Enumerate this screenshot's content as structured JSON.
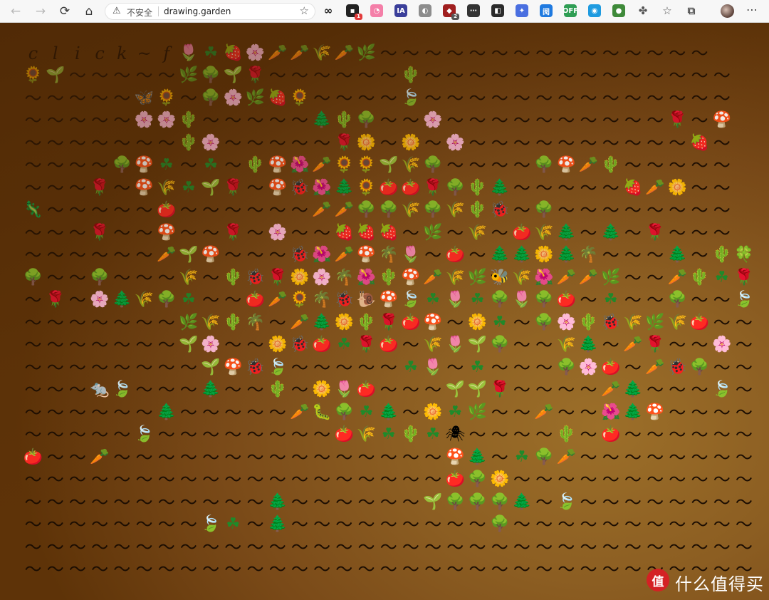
{
  "browser": {
    "back_glyph": "←",
    "forward_glyph": "→",
    "reload_glyph": "⟳",
    "home_glyph": "⌂",
    "security_label": "不安全",
    "url": "drawing.garden",
    "extensions": [
      {
        "icon": "infinity-ext-icon",
        "glyph": "∞",
        "color": "#202020",
        "badge": ""
      },
      {
        "icon": "tampermonkey-ext-icon",
        "glyph": "▪",
        "color": "#222222",
        "badge": "1"
      },
      {
        "icon": "pink-cat-ext-icon",
        "glyph": "◔",
        "color": "#f47fa8",
        "badge": ""
      },
      {
        "icon": "ia-ext-icon",
        "glyph": "IA",
        "color": "#3b3f9a",
        "badge": ""
      },
      {
        "icon": "mouse-ext-icon",
        "glyph": "◐",
        "color": "#8d8d8d",
        "badge": ""
      },
      {
        "icon": "ublock-ext-icon",
        "glyph": "◆",
        "color": "#a01f1f",
        "badge": "2"
      },
      {
        "icon": "dots-ext-icon",
        "glyph": "⋯",
        "color": "#333333",
        "badge": ""
      },
      {
        "icon": "screenshot-ext-icon",
        "glyph": "◧",
        "color": "#2b2b2b",
        "badge": ""
      },
      {
        "icon": "swift-ext-icon",
        "glyph": "✦",
        "color": "#4a6fe0",
        "badge": ""
      },
      {
        "icon": "bracket-ext-icon",
        "glyph": "阅",
        "color": "#1f7ae0",
        "badge": ""
      },
      {
        "icon": "toggle-ext-icon",
        "glyph": "OFF",
        "color": "#2f9e54",
        "badge": ""
      },
      {
        "icon": "shield-ext-icon",
        "glyph": "◉",
        "color": "#1f9be0",
        "badge": ""
      },
      {
        "icon": "turtle-ext-icon",
        "glyph": "●",
        "color": "#3f8a3a",
        "badge": ""
      },
      {
        "icon": "puzzle-ext-icon",
        "glyph": "✤",
        "color": "#555555",
        "badge": ""
      },
      {
        "icon": "favorites-ext-icon",
        "glyph": "☆",
        "color": "#555555",
        "badge": ""
      },
      {
        "icon": "collections-ext-icon",
        "glyph": "⧉",
        "color": "#555555",
        "badge": ""
      }
    ],
    "menu_glyph": "⋯"
  },
  "garden": {
    "header_letters": [
      "c",
      "l",
      "i",
      "c",
      "k",
      "~",
      "f"
    ],
    "rows": [
      "       R$%T@@H@X~~~~~~~~~~~~~~~",
      "SI~~~~~X#ID~~~~~~L~~~~~~~~~~~~~~",
      "~~~~~BW~#TX%W~~~~Z~~~~~~~~~~~~~~",
      "~~~~~TTL~~~~~FL#~~T~~~~~~~~~~D~M",
      "~~~~~~~LT~~~~~DP~Y~T~~~~~~~~~~%~",
      "~~~~#M$~$~LMU@VWIH#~~~~#M@L~~~~~",
      "~~~D~MH$ID~MQUFVAAD#LF~~~~~%@P~~",
      "G~~~~~A~~~~~~@@##H#HLQ~#~~~~~~~~",
      "~~~D~~M~~D~T~~%%%~X~H~AHF~F~D~~~",
      "~~~~~~@IM~~~QU@M*R~A~FFPF*~~~F~LCTD~I~",
      "#~~#~~~H~LQDPT*ULM@HXEHU@@X~~@L$D@TL~@",
      "~D~TFH#$~~A@V*QOMZ$R$#R#A~$~~#~~Z~~X~",
      "~~~~~~~XHL*~@FPLDAM~P$~#TLQHXHA~~X~~~~",
      "~~~~~~~IT~~PQA$DA~HRI#~~HF~@D~~T~~~~",
      "~~~~~~~~IMQZ~~~~~$R~$~~~#TA~@Q#~~AZ~~",
      "~~~KZ~~~F~~L~PRA~~~IID~~~~@F~~~Z~~~~",
      "~~~~~~F~~~~~@N#$F~P$X~~@~~UFM~~~~~~~",
      "~~~~~Z~~~~~~~~AH$L$J~~~~L~A~~~~~~~~~",
      "A~~@~~~~~~~~~~~~~~~MF~$#@~~~~~~~~~~~",
      "~~~~~~~~~~~~~~~~~~~A#P~~~~~~~~~~~~~~",
      "~~~~~~~~~~~F~~~~~~I###F~Z~~~~~~~~~~~",
      "~~~~~~~~Z$~F~~~~~~~~~#~~~~~~~~~~~~~~",
      "~~~~~~~~~~~~~~~~~~~~~~~~~~~~~~~~~~~~",
      "~~~~~~~~~~~~~~~~~~~~~~~~~~~~~~~~~~~~"
    ],
    "legend": {
      "~": "〜",
      "T": "🌸",
      "R": "🌷",
      "$": "☘",
      "%": "🍓",
      "@": "🥕",
      "H": "🌾",
      "X": "🌿",
      "S": "🌻",
      "I": "🌱",
      "D": "🌹",
      "#": "🌳",
      "B": "🦋",
      "L": "🌵",
      "W": "🌻",
      "Z": "🍃",
      "F": "🌲",
      "M": "🍄",
      "Y": "🌼",
      "P": "🌼",
      "U": "🌺",
      "Q": "🐞",
      "V": "🌻",
      "A": "🍅",
      "G": "🦎",
      "E": "🐝",
      "O": "🐌",
      "*": "🌴",
      "C": "🍀",
      "K": "🐀",
      "N": "🐛",
      "J": "🕷"
    }
  },
  "watermark": {
    "logo_text": "值",
    "text": "什么值得买"
  }
}
